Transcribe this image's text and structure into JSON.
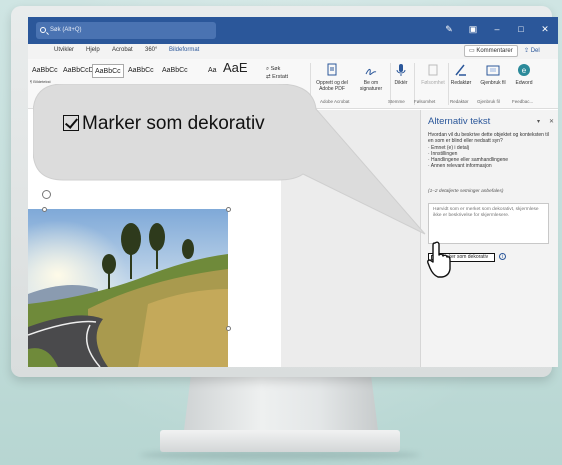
{
  "titlebar": {
    "search_text": "Søk (Alt+Q)",
    "icons": [
      "pen-icon",
      "layout-icon",
      "minimize-icon",
      "restore-icon",
      "close-icon"
    ]
  },
  "tabs": [
    "Utvikler",
    "Hjelp",
    "Acrobat",
    "360°",
    "Bildeformat"
  ],
  "active_tab": "Bildeformat",
  "comments_label": "Kommentarer",
  "share_label": "Del",
  "styles": {
    "items": [
      "AaBbCc",
      "AaBbCcD",
      "AaBbCc",
      "AaBbCc",
      "AaBbCc",
      "Aa",
      "AaE"
    ],
    "caption": "¶ Bildetekst",
    "selected_index": 2
  },
  "ribbon": {
    "sok": "Søk",
    "erstatt": "Erstatt",
    "buttons": [
      {
        "label": "Opprett og del Adobe PDF",
        "icon": "pdf-icon"
      },
      {
        "label": "Be om signaturer",
        "icon": "signature-icon"
      },
      {
        "label": "Diktér",
        "icon": "microphone-icon"
      },
      {
        "label": "Følsomhet",
        "icon": "sensitivity-icon"
      },
      {
        "label": "Redaktør",
        "icon": "editor-icon"
      },
      {
        "label": "Gjenbruk fil",
        "icon": "reuse-file-icon"
      },
      {
        "label": "Edword",
        "icon": "edword-icon"
      }
    ],
    "groups": [
      "Adobe Acrobat",
      "Stemme",
      "Følsomhet",
      "Redaktør",
      "Gjenbruk fil",
      "Feedbac..."
    ]
  },
  "pane": {
    "title": "Alternativ tekst",
    "description": "Hvordan vil du beskrive dette objektet og konteksten til en som er blind eller nedsatt syn?",
    "bullets": [
      "· Emnet (e) i detalj",
      "· Innstillingen",
      "· Handlingene eller samhandlingene",
      "· Annen relevant informasjon"
    ],
    "hint": "(1–2 detaljerte setninger anbefales)",
    "placeholder": "Hørvidt som er merket som dekorativt, skjermlese ikke er beskrivelse for skjermlesere.",
    "decorative_label": "Marker som dekorativ",
    "decorative_checked": false
  },
  "callout": {
    "label": "Marker som dekorativ",
    "checked": true
  }
}
